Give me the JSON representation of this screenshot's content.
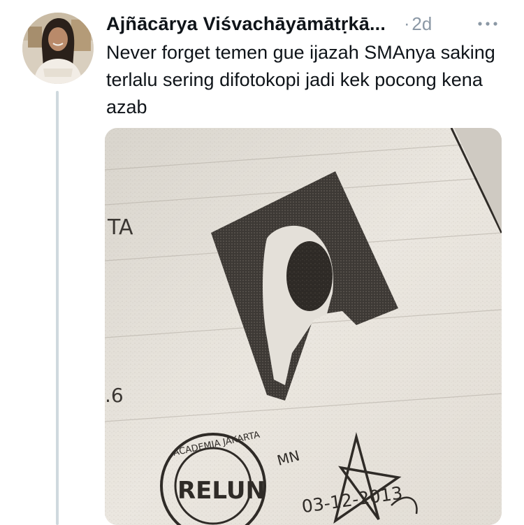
{
  "tweet": {
    "author_name": "Ajñācārya Viśvachāyāmātṛkā...",
    "separator": "·",
    "timestamp": "2d",
    "text": "Never forget temen gue ijazah SMAnya saking terlalu sering difotokopi jadi kek pocong kena azab",
    "more_icon": "ellipsis-icon",
    "avatar_icon": "profile-avatar"
  },
  "media": {
    "visible_text": {
      "side_fragment": "TA",
      "number_fragment": ".6",
      "stamp_text": "RELUN",
      "stamp_top_arc": "ACADEMIA JAKARTA",
      "handwritten_date": "03-12-2013",
      "small_text": "MN"
    }
  },
  "colors": {
    "text_primary": "#0f1419",
    "text_secondary": "#8b98a5",
    "thread_line": "#cfd9de",
    "paper": "#ebe6de",
    "ink": "#3a3632"
  }
}
